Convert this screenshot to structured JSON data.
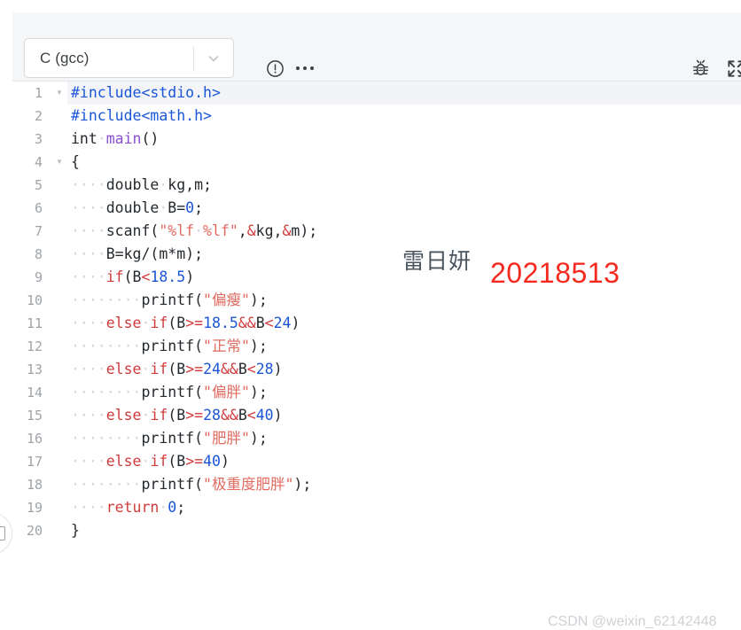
{
  "toolbar": {
    "language_select": {
      "value": "C (gcc)",
      "caret_icon": "chevron-down-icon"
    },
    "info_icon": "info-circle-icon",
    "more_icon": "more-horizontal-icon",
    "debug_icon": "bug-icon",
    "fullscreen_icon": "fullscreen-expand-icon"
  },
  "left_fab": {
    "icon": "square-outline-icon"
  },
  "editor": {
    "active_line": 1,
    "fold_lines": [
      1,
      4
    ],
    "colors": {
      "preprocessor": "#1a56d6",
      "keyword": "#d13b3b",
      "number": "#1a56d6",
      "string": "#e06a60",
      "function": "#8a4fd3",
      "operator": "#d13b3b",
      "plain": "#24292e",
      "line_number": "#a0a4a8",
      "active_line_bg": "#f2f4f8",
      "whitespace_dot": "#d2d6db"
    },
    "lines": [
      {
        "n": "1",
        "tokens": [
          {
            "t": "#include<stdio.h>",
            "c": "t-pre"
          }
        ]
      },
      {
        "n": "2",
        "tokens": [
          {
            "t": "#include<math.h>",
            "c": "t-pre"
          }
        ]
      },
      {
        "n": "3",
        "tokens": [
          {
            "t": "int",
            "c": "t-type"
          },
          {
            "t": "·",
            "c": "ws"
          },
          {
            "t": "main",
            "c": "t-fn"
          },
          {
            "t": "()",
            "c": "t-plain"
          }
        ]
      },
      {
        "n": "4",
        "tokens": [
          {
            "t": "{",
            "c": "t-plain"
          }
        ]
      },
      {
        "n": "5",
        "tokens": [
          {
            "t": "····",
            "c": "ws"
          },
          {
            "t": "double",
            "c": "t-type"
          },
          {
            "t": "·",
            "c": "ws"
          },
          {
            "t": "kg,m;",
            "c": "t-plain"
          }
        ]
      },
      {
        "n": "6",
        "tokens": [
          {
            "t": "····",
            "c": "ws"
          },
          {
            "t": "double",
            "c": "t-type"
          },
          {
            "t": "·",
            "c": "ws"
          },
          {
            "t": "B",
            "c": "t-plain"
          },
          {
            "t": "=",
            "c": "t-plain"
          },
          {
            "t": "0",
            "c": "t-num"
          },
          {
            "t": ";",
            "c": "t-plain"
          }
        ]
      },
      {
        "n": "7",
        "tokens": [
          {
            "t": "····",
            "c": "ws"
          },
          {
            "t": "scanf(",
            "c": "t-plain"
          },
          {
            "t": "\"%lf",
            "c": "t-str"
          },
          {
            "t": "·",
            "c": "ws"
          },
          {
            "t": "%lf\"",
            "c": "t-str"
          },
          {
            "t": ",",
            "c": "t-plain"
          },
          {
            "t": "&",
            "c": "t-op"
          },
          {
            "t": "kg,",
            "c": "t-plain"
          },
          {
            "t": "&",
            "c": "t-op"
          },
          {
            "t": "m);",
            "c": "t-plain"
          }
        ]
      },
      {
        "n": "8",
        "tokens": [
          {
            "t": "····",
            "c": "ws"
          },
          {
            "t": "B=kg/(m*m);",
            "c": "t-plain"
          }
        ]
      },
      {
        "n": "9",
        "tokens": [
          {
            "t": "····",
            "c": "ws"
          },
          {
            "t": "if",
            "c": "t-kw"
          },
          {
            "t": "(B",
            "c": "t-plain"
          },
          {
            "t": "<",
            "c": "t-op"
          },
          {
            "t": "18.5",
            "c": "t-num"
          },
          {
            "t": ")",
            "c": "t-plain"
          }
        ]
      },
      {
        "n": "10",
        "tokens": [
          {
            "t": "········",
            "c": "ws"
          },
          {
            "t": "printf(",
            "c": "t-plain"
          },
          {
            "t": "\"偏瘦\"",
            "c": "t-str"
          },
          {
            "t": ");",
            "c": "t-plain"
          }
        ]
      },
      {
        "n": "11",
        "tokens": [
          {
            "t": "····",
            "c": "ws"
          },
          {
            "t": "else",
            "c": "t-kw"
          },
          {
            "t": "·",
            "c": "ws"
          },
          {
            "t": "if",
            "c": "t-kw"
          },
          {
            "t": "(B",
            "c": "t-plain"
          },
          {
            "t": ">=",
            "c": "t-op"
          },
          {
            "t": "18.5",
            "c": "t-num"
          },
          {
            "t": "&&",
            "c": "t-op"
          },
          {
            "t": "B",
            "c": "t-plain"
          },
          {
            "t": "<",
            "c": "t-op"
          },
          {
            "t": "24",
            "c": "t-num"
          },
          {
            "t": ")",
            "c": "t-plain"
          }
        ]
      },
      {
        "n": "12",
        "tokens": [
          {
            "t": "········",
            "c": "ws"
          },
          {
            "t": "printf(",
            "c": "t-plain"
          },
          {
            "t": "\"正常\"",
            "c": "t-str"
          },
          {
            "t": ");",
            "c": "t-plain"
          }
        ]
      },
      {
        "n": "13",
        "tokens": [
          {
            "t": "····",
            "c": "ws"
          },
          {
            "t": "else",
            "c": "t-kw"
          },
          {
            "t": "·",
            "c": "ws"
          },
          {
            "t": "if",
            "c": "t-kw"
          },
          {
            "t": "(B",
            "c": "t-plain"
          },
          {
            "t": ">=",
            "c": "t-op"
          },
          {
            "t": "24",
            "c": "t-num"
          },
          {
            "t": "&&",
            "c": "t-op"
          },
          {
            "t": "B",
            "c": "t-plain"
          },
          {
            "t": "<",
            "c": "t-op"
          },
          {
            "t": "28",
            "c": "t-num"
          },
          {
            "t": ")",
            "c": "t-plain"
          }
        ]
      },
      {
        "n": "14",
        "tokens": [
          {
            "t": "········",
            "c": "ws"
          },
          {
            "t": "printf(",
            "c": "t-plain"
          },
          {
            "t": "\"偏胖\"",
            "c": "t-str"
          },
          {
            "t": ");",
            "c": "t-plain"
          }
        ]
      },
      {
        "n": "15",
        "tokens": [
          {
            "t": "····",
            "c": "ws"
          },
          {
            "t": "else",
            "c": "t-kw"
          },
          {
            "t": "·",
            "c": "ws"
          },
          {
            "t": "if",
            "c": "t-kw"
          },
          {
            "t": "(B",
            "c": "t-plain"
          },
          {
            "t": ">=",
            "c": "t-op"
          },
          {
            "t": "28",
            "c": "t-num"
          },
          {
            "t": "&&",
            "c": "t-op"
          },
          {
            "t": "B",
            "c": "t-plain"
          },
          {
            "t": "<",
            "c": "t-op"
          },
          {
            "t": "40",
            "c": "t-num"
          },
          {
            "t": ")",
            "c": "t-plain"
          }
        ]
      },
      {
        "n": "16",
        "tokens": [
          {
            "t": "········",
            "c": "ws"
          },
          {
            "t": "printf(",
            "c": "t-plain"
          },
          {
            "t": "\"肥胖\"",
            "c": "t-str"
          },
          {
            "t": ");",
            "c": "t-plain"
          }
        ]
      },
      {
        "n": "17",
        "tokens": [
          {
            "t": "····",
            "c": "ws"
          },
          {
            "t": "else",
            "c": "t-kw"
          },
          {
            "t": "·",
            "c": "ws"
          },
          {
            "t": "if",
            "c": "t-kw"
          },
          {
            "t": "(B",
            "c": "t-plain"
          },
          {
            "t": ">=",
            "c": "t-op"
          },
          {
            "t": "40",
            "c": "t-num"
          },
          {
            "t": ")",
            "c": "t-plain"
          }
        ]
      },
      {
        "n": "18",
        "tokens": [
          {
            "t": "········",
            "c": "ws"
          },
          {
            "t": "printf(",
            "c": "t-plain"
          },
          {
            "t": "\"极重度肥胖\"",
            "c": "t-str"
          },
          {
            "t": ");",
            "c": "t-plain"
          }
        ]
      },
      {
        "n": "19",
        "tokens": [
          {
            "t": "····",
            "c": "ws"
          },
          {
            "t": "return",
            "c": "t-kw"
          },
          {
            "t": "·",
            "c": "ws"
          },
          {
            "t": "0",
            "c": "t-num"
          },
          {
            "t": ";",
            "c": "t-plain"
          }
        ]
      },
      {
        "n": "20",
        "tokens": [
          {
            "t": "}",
            "c": "t-plain"
          }
        ]
      }
    ]
  },
  "overlays": {
    "author_name": "雷日妍",
    "student_id": "20218513",
    "csdn_watermark": "CSDN @weixin_62142448"
  }
}
